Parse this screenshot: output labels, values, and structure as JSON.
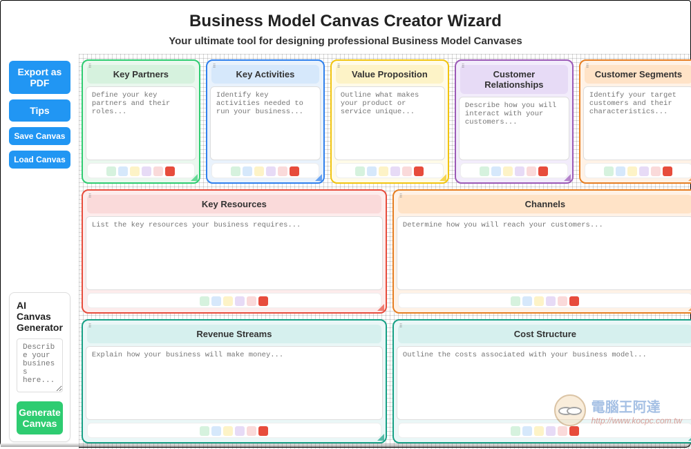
{
  "header": {
    "title": "Business Model Canvas Creator Wizard",
    "subtitle": "Your ultimate tool for designing professional Business Model Canvases"
  },
  "sidebar": {
    "export_pdf": "Export as PDF",
    "tips": "Tips",
    "save": "Save Canvas",
    "load": "Load Canvas"
  },
  "ai": {
    "title": "AI Canvas Generator",
    "placeholder": "Describe your business here...",
    "generate": "Generate Canvas"
  },
  "cards": {
    "key_partners": {
      "title": "Key Partners",
      "placeholder": "Define your key partners and their roles..."
    },
    "key_activities": {
      "title": "Key Activities",
      "placeholder": "Identify key activities needed to run your business..."
    },
    "value_proposition": {
      "title": "Value Proposition",
      "placeholder": "Outline what makes your product or service unique..."
    },
    "customer_relations": {
      "title": "Customer Relationships",
      "placeholder": "Describe how you will interact with your customers..."
    },
    "customer_segments": {
      "title": "Customer Segments",
      "placeholder": "Identify your target customers and their characteristics..."
    },
    "key_resources": {
      "title": "Key Resources",
      "placeholder": "List the key resources your business requires..."
    },
    "channels": {
      "title": "Channels",
      "placeholder": "Determine how you will reach your customers..."
    },
    "revenue_streams": {
      "title": "Revenue Streams",
      "placeholder": "Explain how your business will make money..."
    },
    "cost_structure": {
      "title": "Cost Structure",
      "placeholder": "Outline the costs associated with your business model..."
    }
  },
  "swatch_colors": [
    "#d6f2de",
    "#d6e8fb",
    "#fdf3c7",
    "#e7dbf6",
    "#fadada",
    "#e74c3c"
  ],
  "watermark": {
    "text": "電腦王阿達",
    "url": "http://www.kocpc.com.tw"
  }
}
